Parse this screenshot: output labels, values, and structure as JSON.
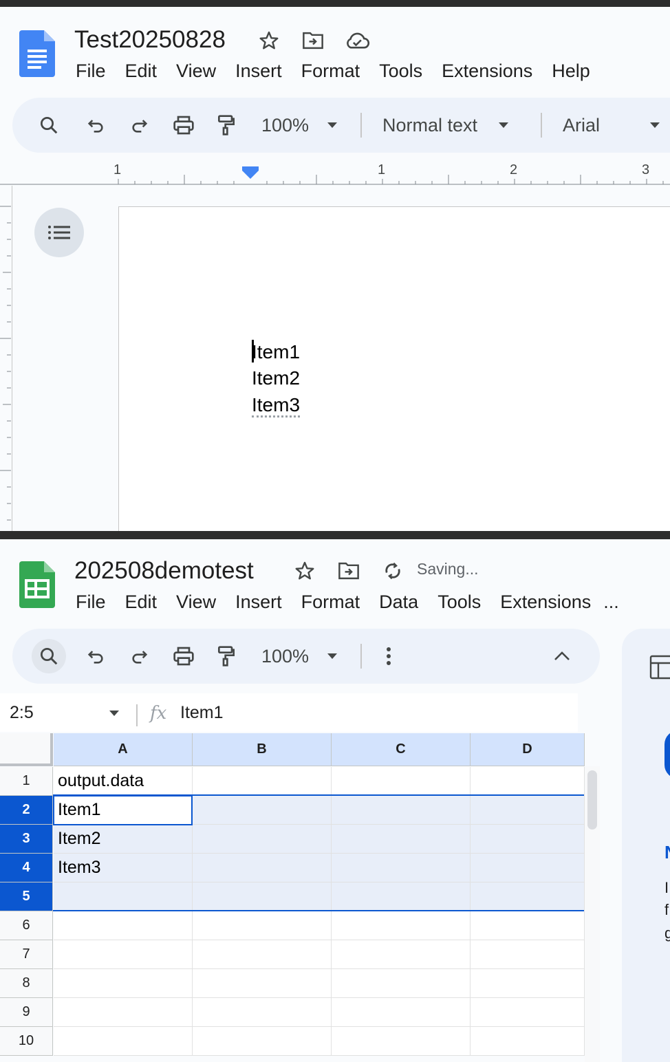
{
  "docs": {
    "title": "Test20250828",
    "menus": [
      "File",
      "Edit",
      "View",
      "Insert",
      "Format",
      "Tools",
      "Extensions",
      "Help"
    ],
    "toolbar": {
      "zoom": "100%",
      "style": "Normal text",
      "font": "Arial"
    },
    "ruler": [
      "1",
      "1",
      "2",
      "3"
    ],
    "lines": [
      "Item1",
      "Item2",
      "Item3"
    ]
  },
  "sheets": {
    "title": "202508demotest",
    "status": "Saving...",
    "menus": [
      "File",
      "Edit",
      "View",
      "Insert",
      "Format",
      "Data",
      "Tools",
      "Extensions",
      "..."
    ],
    "toolbar": {
      "zoom": "100%"
    },
    "namebox": "2:5",
    "formula": "Item1",
    "columns": [
      "A",
      "B",
      "C",
      "D"
    ],
    "rows": [
      "1",
      "2",
      "3",
      "4",
      "5",
      "6",
      "7",
      "8",
      "9",
      "10"
    ],
    "cells_a": [
      "output.data",
      "Item1",
      "Item2",
      "Item3",
      "",
      "",
      "",
      "",
      "",
      ""
    ],
    "side": {
      "l1": "N",
      "l2": "I",
      "l3": "f",
      "l4": "g"
    }
  },
  "colors": {
    "accent": "#0b57d0",
    "docs_blue": "#4285f4",
    "sheets_green": "#34a853",
    "toolbar_bg": "#edf2fa"
  }
}
